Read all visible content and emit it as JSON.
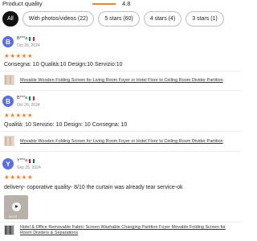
{
  "product_quality": {
    "label": "Product quality",
    "value": "4.8",
    "fraction": 0.96
  },
  "filters": [
    {
      "label": "All",
      "active": true
    },
    {
      "label": "With photos/videos (22)",
      "active": false
    },
    {
      "label": "5 stars (60)",
      "active": false
    },
    {
      "label": "4 stars (4)",
      "active": false
    },
    {
      "label": "3 stars (1)",
      "active": false
    }
  ],
  "reviews": [
    {
      "avatar_letter": "B",
      "name": "B***a",
      "flag": [
        "#009246",
        "#ffffff",
        "#ce2b37"
      ],
      "date": "Oct 26, 2024",
      "stars": "★★★★★",
      "text": "Consegna: 10 Qualità:10  Design:10  Servizio:10",
      "product": "Movable Wooden Folding Screen for Living Room Foyer or Hotel Floor to Ceiling Room Divider Partition"
    },
    {
      "avatar_letter": "B",
      "name": "B***a",
      "flag": [
        "#009246",
        "#ffffff",
        "#ce2b37"
      ],
      "date": "Oct 26, 2024",
      "stars": "★★★★★",
      "text": "Qualità: 10 Servizio: 10 Design: 10 Consegna: 10",
      "product": "Movable Wooden Folding Screen for Living Room Foyer or Hotel Floor to Ceiling Room Divider Partition"
    },
    {
      "avatar_letter": "Y",
      "name": "Y***a",
      "flag": [
        "#ce1126",
        "#ffffff",
        "#007a3d"
      ],
      "date": "Sep 25, 2024",
      "stars": "★★★★★",
      "text": "delivery- coporative quality- 8/10 the curtain was already tear service-ok",
      "photo_duration": "00:10",
      "product": "Hotel & Office Removable Fabric Screen Washable Changing Partition Foyer Movable Folding Screen for Room Dividers & Separations"
    }
  ]
}
